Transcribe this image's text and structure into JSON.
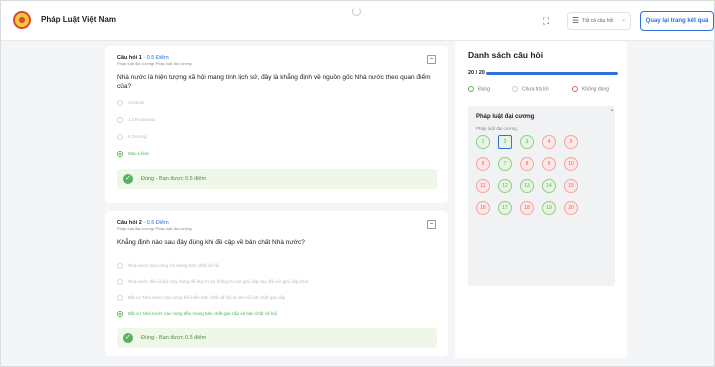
{
  "header": {
    "app_title": "Pháp Luật Việt Nam",
    "filter_label": "Tất cả câu hỏi",
    "back_button": "Quay lại trang kết quả"
  },
  "questions": [
    {
      "label": "Câu hỏi 1",
      "points": "- 0.5 Điểm",
      "breadcrumb": "Pháp luật đại cương/ Pháp luật đại cương",
      "text": "Nhà nước là hiện tượng xã hội mang tính lịch sử, đây là khẳng định về nguồn gốc Nhà nước theo quan điểm của?",
      "options": [
        "Aristotle",
        "J.J.Rousseau",
        "K.Dương",
        "Mác-Lênin"
      ],
      "selected_index": 3,
      "result": "Đúng - Bạn được 0.5 điểm"
    },
    {
      "label": "Câu hỏi 2",
      "points": "- 0.5 Điểm",
      "breadcrumb": "Pháp luật đại cương/ Pháp luật đại cương",
      "text": "Khẳng định nào sau đây đúng khi đề cập về bản chất Nhà nước?",
      "options": [
        "Nhà nước nào cũng chỉ mang bản chất xã hội",
        "Nhà nước đều là bộ máy dùng để duy trì sự thống trị của giai cấp này đối với giai cấp khác",
        "Bất cứ Nhà nước nào cũng thể hiện bản chất xã hội là nét nổi bật chất giai cấp",
        "Bất cứ Nhà nước nào cũng đều mang bản chất giai cấp và bản chất xã hội"
      ],
      "selected_index": 3,
      "result": "Đúng - Bạn được 0.5 điểm"
    }
  ],
  "panel": {
    "title": "Danh sách câu hỏi",
    "progress_text": "20 / 20",
    "progress_fraction": 1.0,
    "legend": [
      "Đúng",
      "Chưa trả lời",
      "Không đúng"
    ],
    "section_title": "Pháp luật đại cương",
    "section_sub": "Pháp luật đại cương",
    "numbers": [
      {
        "n": "1",
        "status": "correct"
      },
      {
        "n": "2",
        "status": "correct",
        "current": true
      },
      {
        "n": "3",
        "status": "correct"
      },
      {
        "n": "4",
        "status": "wrong"
      },
      {
        "n": "5",
        "status": "wrong"
      },
      {
        "n": "6",
        "status": "wrong"
      },
      {
        "n": "7",
        "status": "correct"
      },
      {
        "n": "8",
        "status": "wrong"
      },
      {
        "n": "9",
        "status": "wrong"
      },
      {
        "n": "10",
        "status": "wrong"
      },
      {
        "n": "11",
        "status": "wrong"
      },
      {
        "n": "12",
        "status": "correct"
      },
      {
        "n": "13",
        "status": "correct"
      },
      {
        "n": "14",
        "status": "correct"
      },
      {
        "n": "15",
        "status": "wrong"
      },
      {
        "n": "16",
        "status": "wrong"
      },
      {
        "n": "17",
        "status": "correct"
      },
      {
        "n": "18",
        "status": "wrong"
      },
      {
        "n": "19",
        "status": "correct"
      },
      {
        "n": "20",
        "status": "wrong"
      }
    ]
  },
  "colors": {
    "accent": "#2f6fe0",
    "correct": "#58b15b",
    "wrong": "#e0625c"
  },
  "icons": {
    "logo": "national-emblem-icon",
    "expand": "expand-icon",
    "filter": "list-icon",
    "flag": "flag-icon",
    "check": "check-circle-icon"
  }
}
